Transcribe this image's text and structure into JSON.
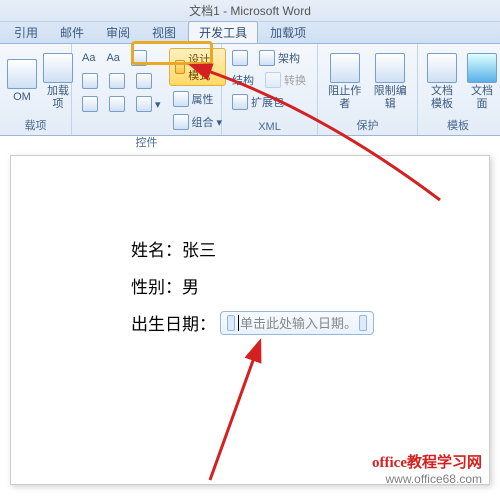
{
  "window_title": "文档1 - Microsoft Word",
  "tabs": {
    "t0": "引用",
    "t1": "邮件",
    "t2": "审阅",
    "t3": "视图",
    "t4": "开发工具",
    "t5": "加载项"
  },
  "ribbon": {
    "group_addins": {
      "btn_om": "OM",
      "btn_addins": "加载项",
      "label": "载项"
    },
    "group_controls": {
      "aa1": "Aa",
      "aa2": "Aa",
      "design_mode": "设计模式",
      "properties": "属性",
      "group_cmd": "组合",
      "label": "控件"
    },
    "group_xml": {
      "schema": "架构",
      "structure": "结构",
      "transform": "转换",
      "expansion": "扩展包",
      "label": "XML"
    },
    "group_protect": {
      "block_authors": "阻止作者",
      "restrict_editing": "限制编辑",
      "label": "保护"
    },
    "group_templates": {
      "doc_template": "文档模板",
      "doc_panel": "文档面",
      "label": "模板"
    }
  },
  "document": {
    "line1_label": "姓名：",
    "line1_value": "张三",
    "line2_label": "性别：",
    "line2_value": "男",
    "line3_label": "出生日期：",
    "date_placeholder": "单击此处输入日期。"
  },
  "watermark": {
    "line1": "office教程学习网",
    "line2": "www.office68.com"
  }
}
